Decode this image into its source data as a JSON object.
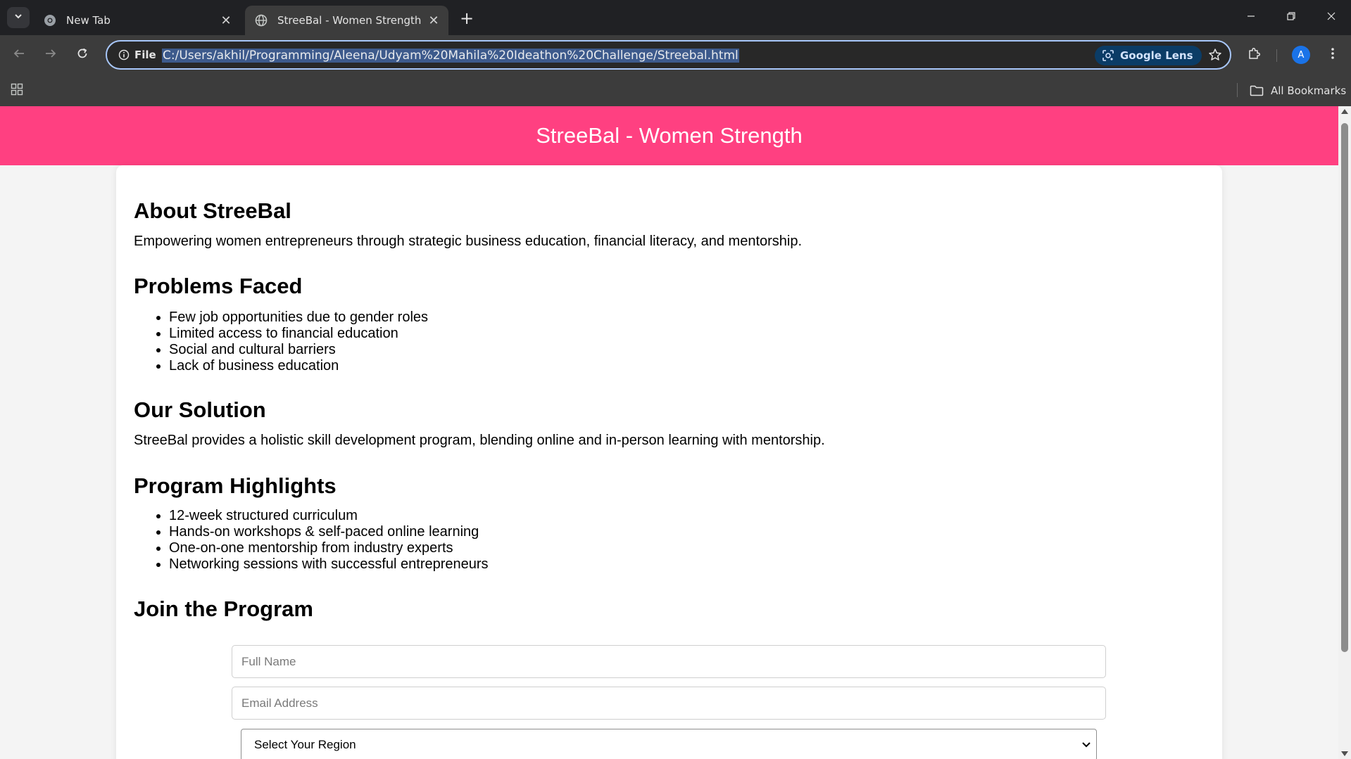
{
  "browser": {
    "tabs": [
      {
        "title": "New Tab",
        "active": false
      },
      {
        "title": "StreeBal - Women Strength",
        "active": true
      }
    ],
    "site_chip": "File",
    "url": "C:/Users/akhil/Programming/Aleena/Udyam%20Mahila%20Ideathon%20Challenge/Streebal.html",
    "lens_label": "Google Lens",
    "avatar_initial": "A",
    "all_bookmarks": "All Bookmarks",
    "colors": {
      "accent": "#a8c7fa",
      "frame": "#202124",
      "toolbar": "#3c3c3c"
    }
  },
  "page": {
    "header_title": "StreeBal - Women Strength",
    "header_color": "#ff4081",
    "about": {
      "heading": "About StreeBal",
      "text": "Empowering women entrepreneurs through strategic business education, financial literacy, and mentorship."
    },
    "problems": {
      "heading": "Problems Faced",
      "items": [
        "Few job opportunities due to gender roles",
        "Limited access to financial education",
        "Social and cultural barriers",
        "Lack of business education"
      ]
    },
    "solution": {
      "heading": "Our Solution",
      "text": "StreeBal provides a holistic skill development program, blending online and in-person learning with mentorship."
    },
    "highlights": {
      "heading": "Program Highlights",
      "items": [
        "12-week structured curriculum",
        "Hands-on workshops & self-paced online learning",
        "One-on-one mentorship from industry experts",
        "Networking sessions with successful entrepreneurs"
      ]
    },
    "join": {
      "heading": "Join the Program",
      "name_placeholder": "Full Name",
      "email_placeholder": "Email Address",
      "region_selected": "Select Your Region"
    }
  }
}
